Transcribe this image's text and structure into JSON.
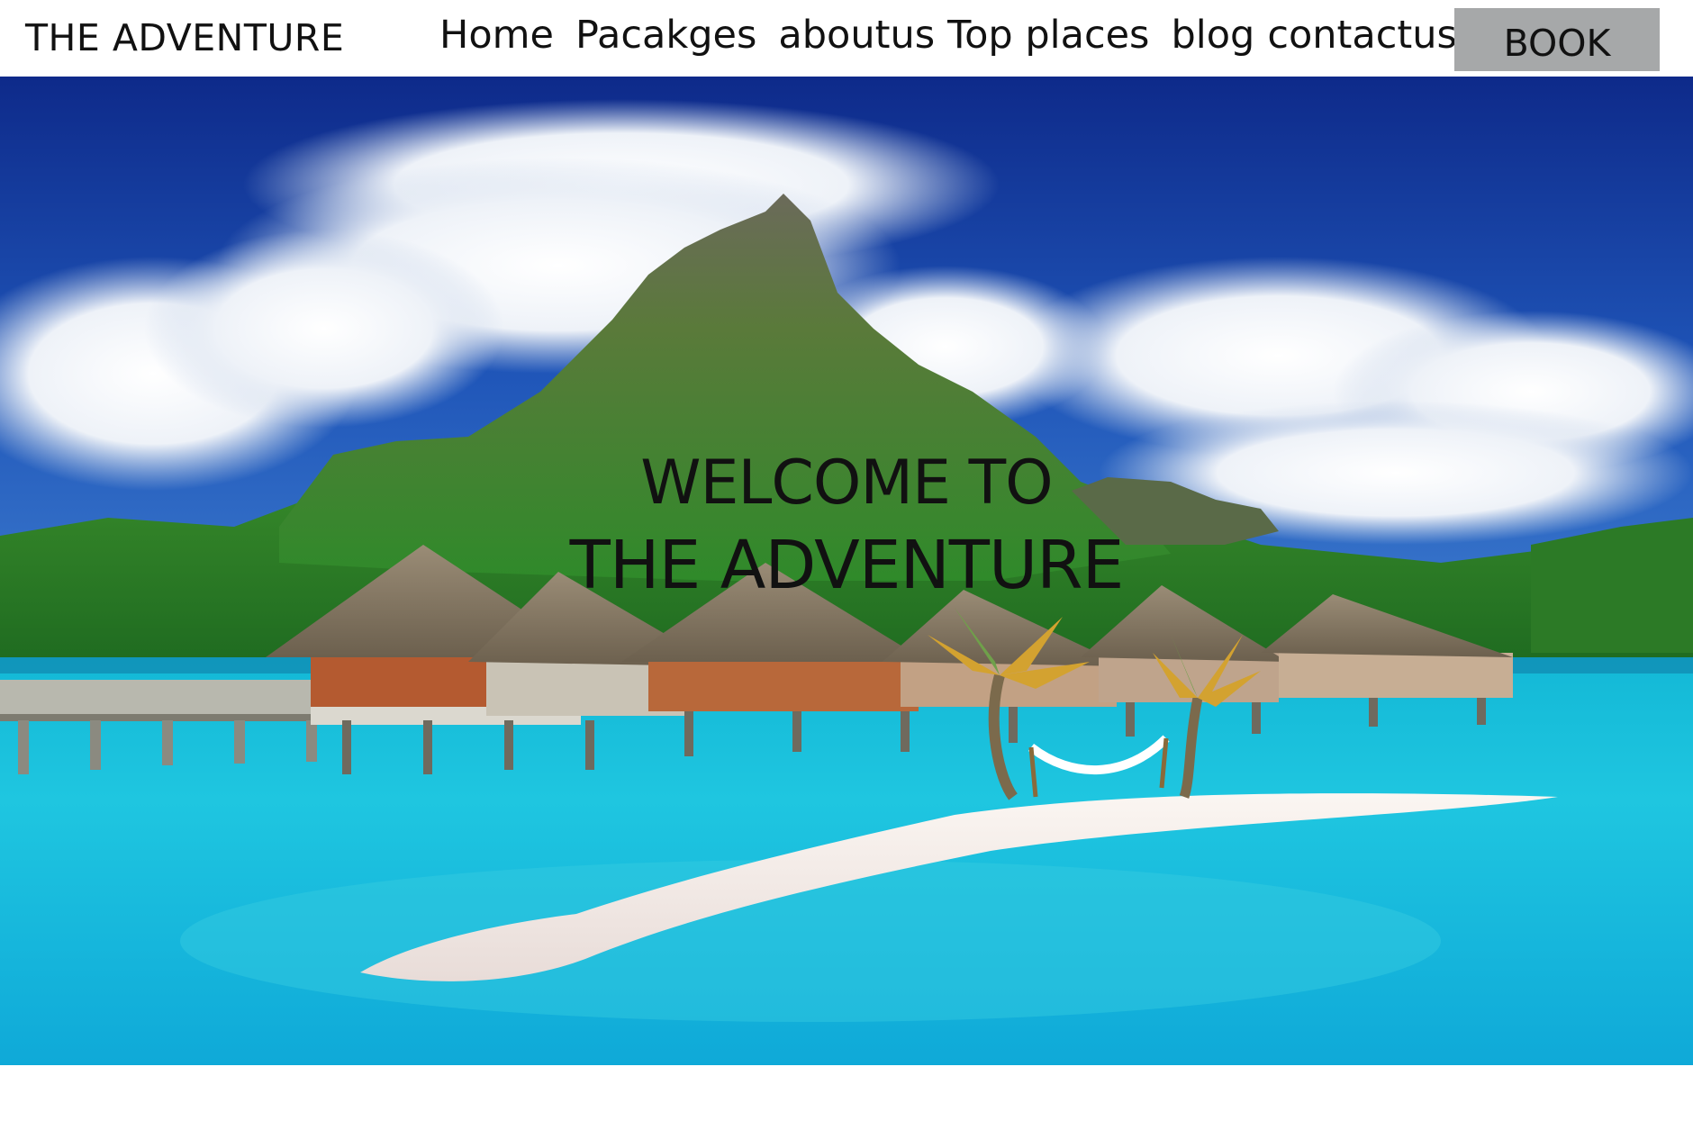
{
  "header": {
    "brand": "THE ADVENTURE",
    "nav": [
      {
        "label": "Home"
      },
      {
        "label": "Pacakges"
      },
      {
        "label": "aboutus"
      },
      {
        "label": "Top places"
      },
      {
        "label": "blog"
      },
      {
        "label": "contactus"
      }
    ],
    "book_label": "BOOK"
  },
  "hero": {
    "line1": "WELCOME TO",
    "line2": "THE ADVENTURE",
    "image": "tropical-island-resort-photo"
  },
  "colors": {
    "book_button_bg": "#a6a8a9",
    "text": "#111111",
    "sky": "#1d46a8",
    "water": "#19c0d8"
  }
}
